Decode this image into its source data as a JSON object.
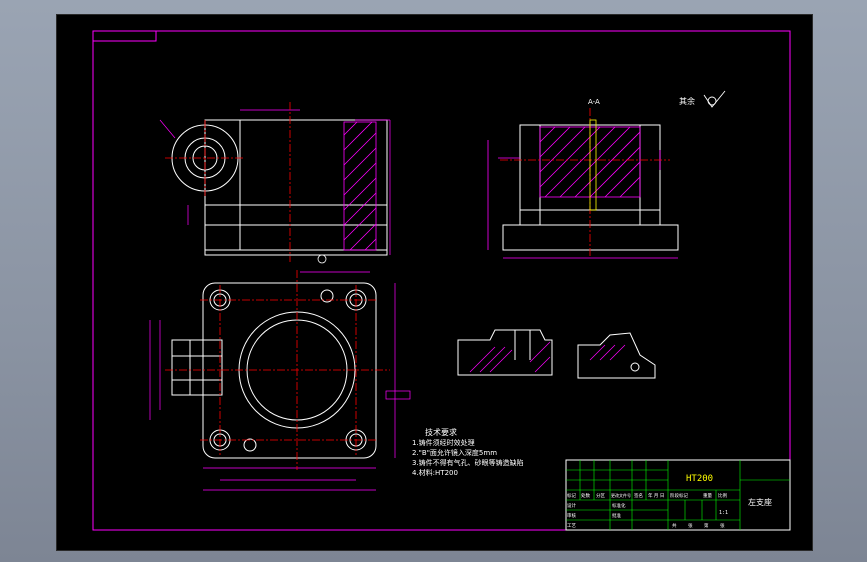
{
  "colors": {
    "border": "#ff00ff",
    "part": "#ffffff",
    "centerline": "#ff0000",
    "dimension": "#ff00ff",
    "hatch": "#ff00ff",
    "note_text": "#ffffff",
    "titleblock_text": "#ffffff",
    "material_text": "#ffff00",
    "green_grid": "#00ff00"
  },
  "section_view": {
    "label": "A-A"
  },
  "roughness": {
    "label": "其余",
    "symbol": "check-roughness-icon"
  },
  "tech_notes": {
    "heading": "技术要求",
    "items": [
      "1.铸件须经时效处理",
      "2.\"B\"面允许镜入深度5mm",
      "3.铸件不得有气孔、砂眼等铸造缺陷",
      "4.材料:HT200"
    ]
  },
  "title_block": {
    "material": "HT200",
    "part_name": "左支座",
    "scale_label": "1:1",
    "row_labels": [
      "标记",
      "处数",
      "分区",
      "更改文件号",
      "签名",
      "年 月 日"
    ],
    "role_labels": [
      "设计",
      "审核",
      "工艺"
    ],
    "sub_labels": [
      "标准化",
      "批准"
    ],
    "stage_labels": [
      "阶段标记",
      "重量",
      "比例"
    ],
    "sheet_labels": [
      "共",
      "张",
      "第",
      "张"
    ]
  }
}
